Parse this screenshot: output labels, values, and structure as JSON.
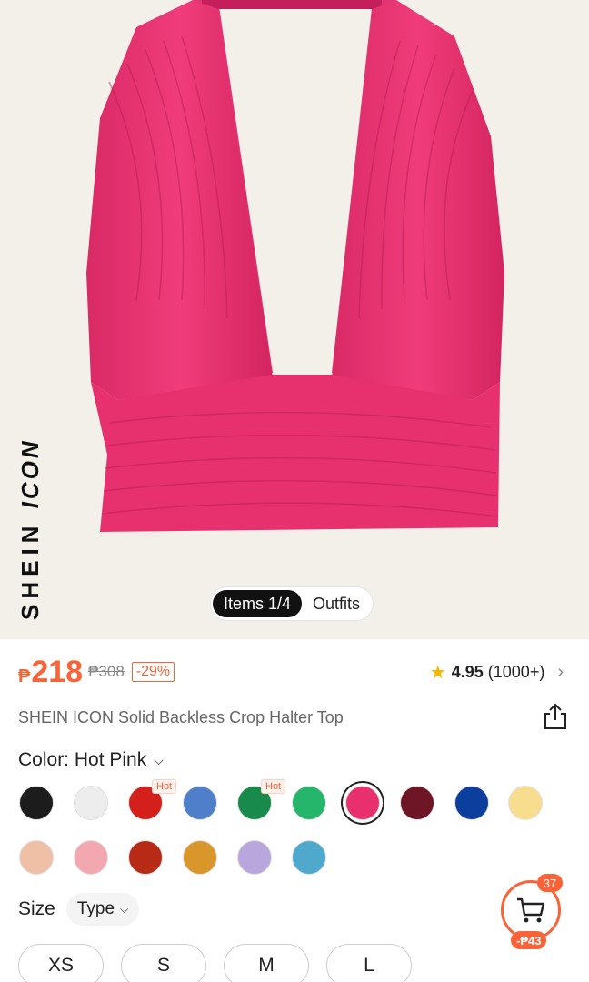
{
  "hero": {
    "brand_a": "SHEIN",
    "brand_b": "ICON",
    "pager_items": "Items 1/4",
    "pager_outfits": "Outfits"
  },
  "price": {
    "currency": "₱",
    "current": "218",
    "original": "₱308",
    "discount": "-29%"
  },
  "rating": {
    "score": "4.95",
    "count": "(1000+)"
  },
  "product": {
    "title": "SHEIN ICON Solid Backless Crop Halter Top"
  },
  "color": {
    "label": "Color: Hot Pink",
    "hot_label": "Hot",
    "swatches": [
      {
        "name": "black",
        "color": "#1c1c1c"
      },
      {
        "name": "white",
        "color": "#ededed"
      },
      {
        "name": "red",
        "color": "#d4201a",
        "hot": true
      },
      {
        "name": "blue",
        "color": "#4f7fc9"
      },
      {
        "name": "green",
        "color": "#178a4c",
        "hot": true
      },
      {
        "name": "light-green",
        "color": "#25b56b"
      },
      {
        "name": "hot-pink",
        "color": "#e8306e",
        "selected": true
      },
      {
        "name": "burgundy",
        "color": "#6e1626"
      },
      {
        "name": "royal-blue",
        "color": "#0c3e9e"
      },
      {
        "name": "yellow",
        "color": "#f8dd8e"
      },
      {
        "name": "nude",
        "color": "#efbfa6"
      },
      {
        "name": "light-pink",
        "color": "#f3a7b0"
      },
      {
        "name": "rust",
        "color": "#b72a16"
      },
      {
        "name": "mustard",
        "color": "#d9962b"
      },
      {
        "name": "lavender",
        "color": "#b9a6dd"
      },
      {
        "name": "sky-blue",
        "color": "#4fa9cc"
      }
    ]
  },
  "size": {
    "label": "Size",
    "type_label": "Type",
    "options": [
      "XS",
      "S",
      "M",
      "L"
    ]
  },
  "cart": {
    "badge": "37",
    "discount": "-₱43"
  },
  "colors": {
    "accent": "#fa6338",
    "garment": "#e8306e"
  }
}
